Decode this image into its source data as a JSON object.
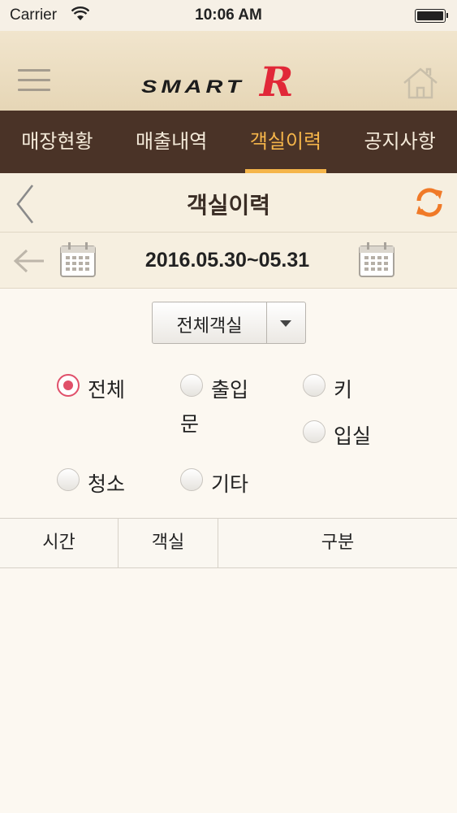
{
  "status_bar": {
    "carrier": "Carrier",
    "time": "10:06 AM"
  },
  "header": {
    "logo_main": "SMART",
    "logo_accent": "R"
  },
  "tabs": [
    {
      "label": "매장현황"
    },
    {
      "label": "매출내역"
    },
    {
      "label": "객실이력",
      "active": true
    },
    {
      "label": "공지사항"
    }
  ],
  "page": {
    "title": "객실이력"
  },
  "date_filter": {
    "range": "2016.05.30~05.31"
  },
  "room_select": {
    "value": "전체객실"
  },
  "filters": [
    {
      "label": "전체",
      "checked": true
    },
    {
      "label": "출입",
      "label_cont": "문",
      "checked": false
    },
    {
      "label": "키",
      "checked": false
    },
    {
      "label": "입실",
      "checked": false
    },
    {
      "label": "청소",
      "checked": false
    },
    {
      "label": "기타",
      "checked": false
    }
  ],
  "table": {
    "columns": [
      "시간",
      "객실",
      "구분"
    ]
  },
  "colors": {
    "tab_bg": "#4a3327",
    "accent": "#f5b54a",
    "refresh": "#f07a28",
    "radio_checked": "#e0506a",
    "logo_r": "#e12838"
  },
  "icons": [
    "wifi-icon",
    "battery-icon",
    "menu-icon",
    "home-icon",
    "back-icon",
    "refresh-icon",
    "arrow-left-icon",
    "calendar-icon"
  ]
}
